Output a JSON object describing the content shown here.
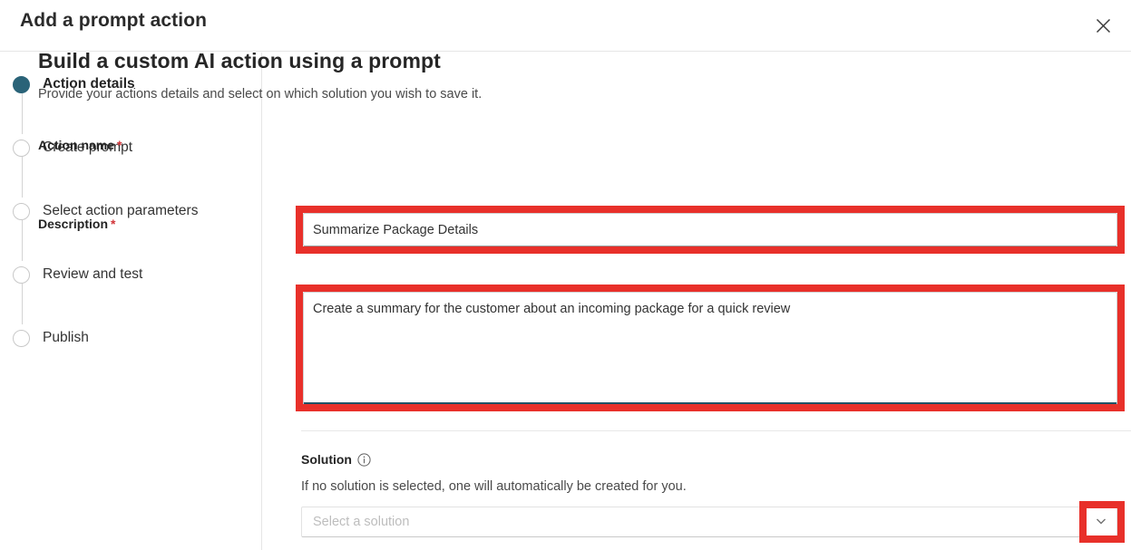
{
  "dialog": {
    "title": "Add a prompt action",
    "close_icon": "close-icon"
  },
  "stepper": {
    "steps": [
      {
        "label": "Action details",
        "state": "active"
      },
      {
        "label": "Create prompt",
        "state": "pending"
      },
      {
        "label": "Select action parameters",
        "state": "pending"
      },
      {
        "label": "Review and test",
        "state": "pending"
      },
      {
        "label": "Publish",
        "state": "pending"
      }
    ],
    "active_color": "#2a6378",
    "pending_color": "#c8c8c8"
  },
  "main": {
    "title": "Build a custom AI action using a prompt",
    "subtitle": "Provide your actions details and select on which solution you wish to save it.",
    "fields": {
      "action_name": {
        "label": "Action name",
        "required_marker": "*",
        "value": "Summarize Package Details",
        "placeholder": ""
      },
      "description": {
        "label": "Description",
        "required_marker": "*",
        "value": "Create a summary for the customer about an incoming package for a quick review",
        "placeholder": ""
      },
      "solution": {
        "label": "Solution",
        "info_icon": "info-icon",
        "help_text": "If no solution is selected, one will automatically be created for you.",
        "value": "",
        "placeholder": "Select a solution",
        "chevron_icon": "chevron-down-icon"
      }
    }
  },
  "annotations": {
    "highlight_color": "#e8302a",
    "boxes": [
      {
        "target": "action-name-input"
      },
      {
        "target": "description-textarea"
      },
      {
        "target": "solution-dropdown-chevron"
      }
    ]
  }
}
